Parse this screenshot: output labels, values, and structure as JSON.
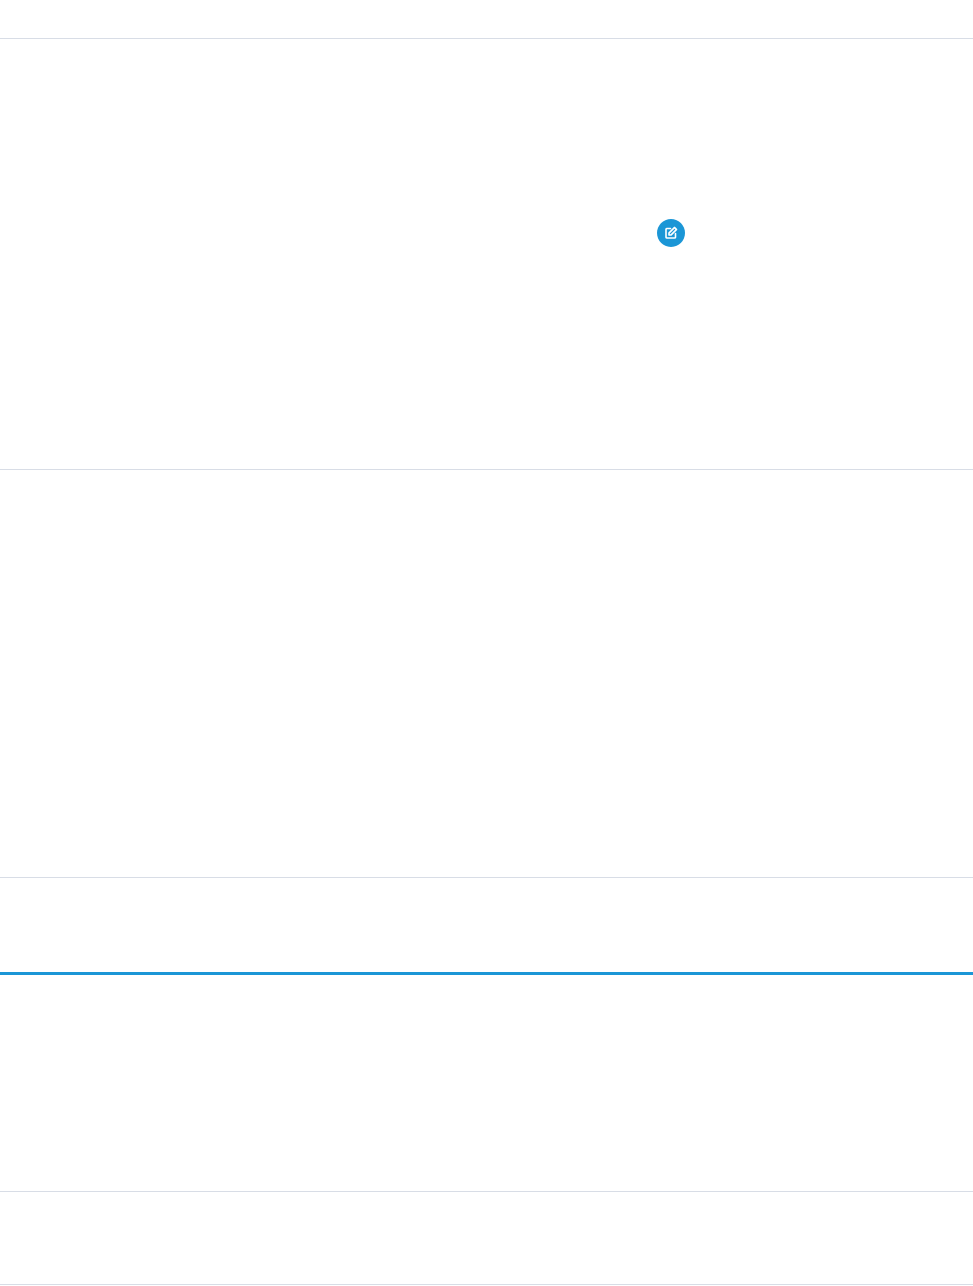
{
  "colors": {
    "background": "#ffffff",
    "divider": "#d8dde6",
    "accent_divider": "#1b96d6",
    "edit_icon_background": "#1b96d6"
  },
  "icons": {
    "edit": "edit-note-icon"
  }
}
